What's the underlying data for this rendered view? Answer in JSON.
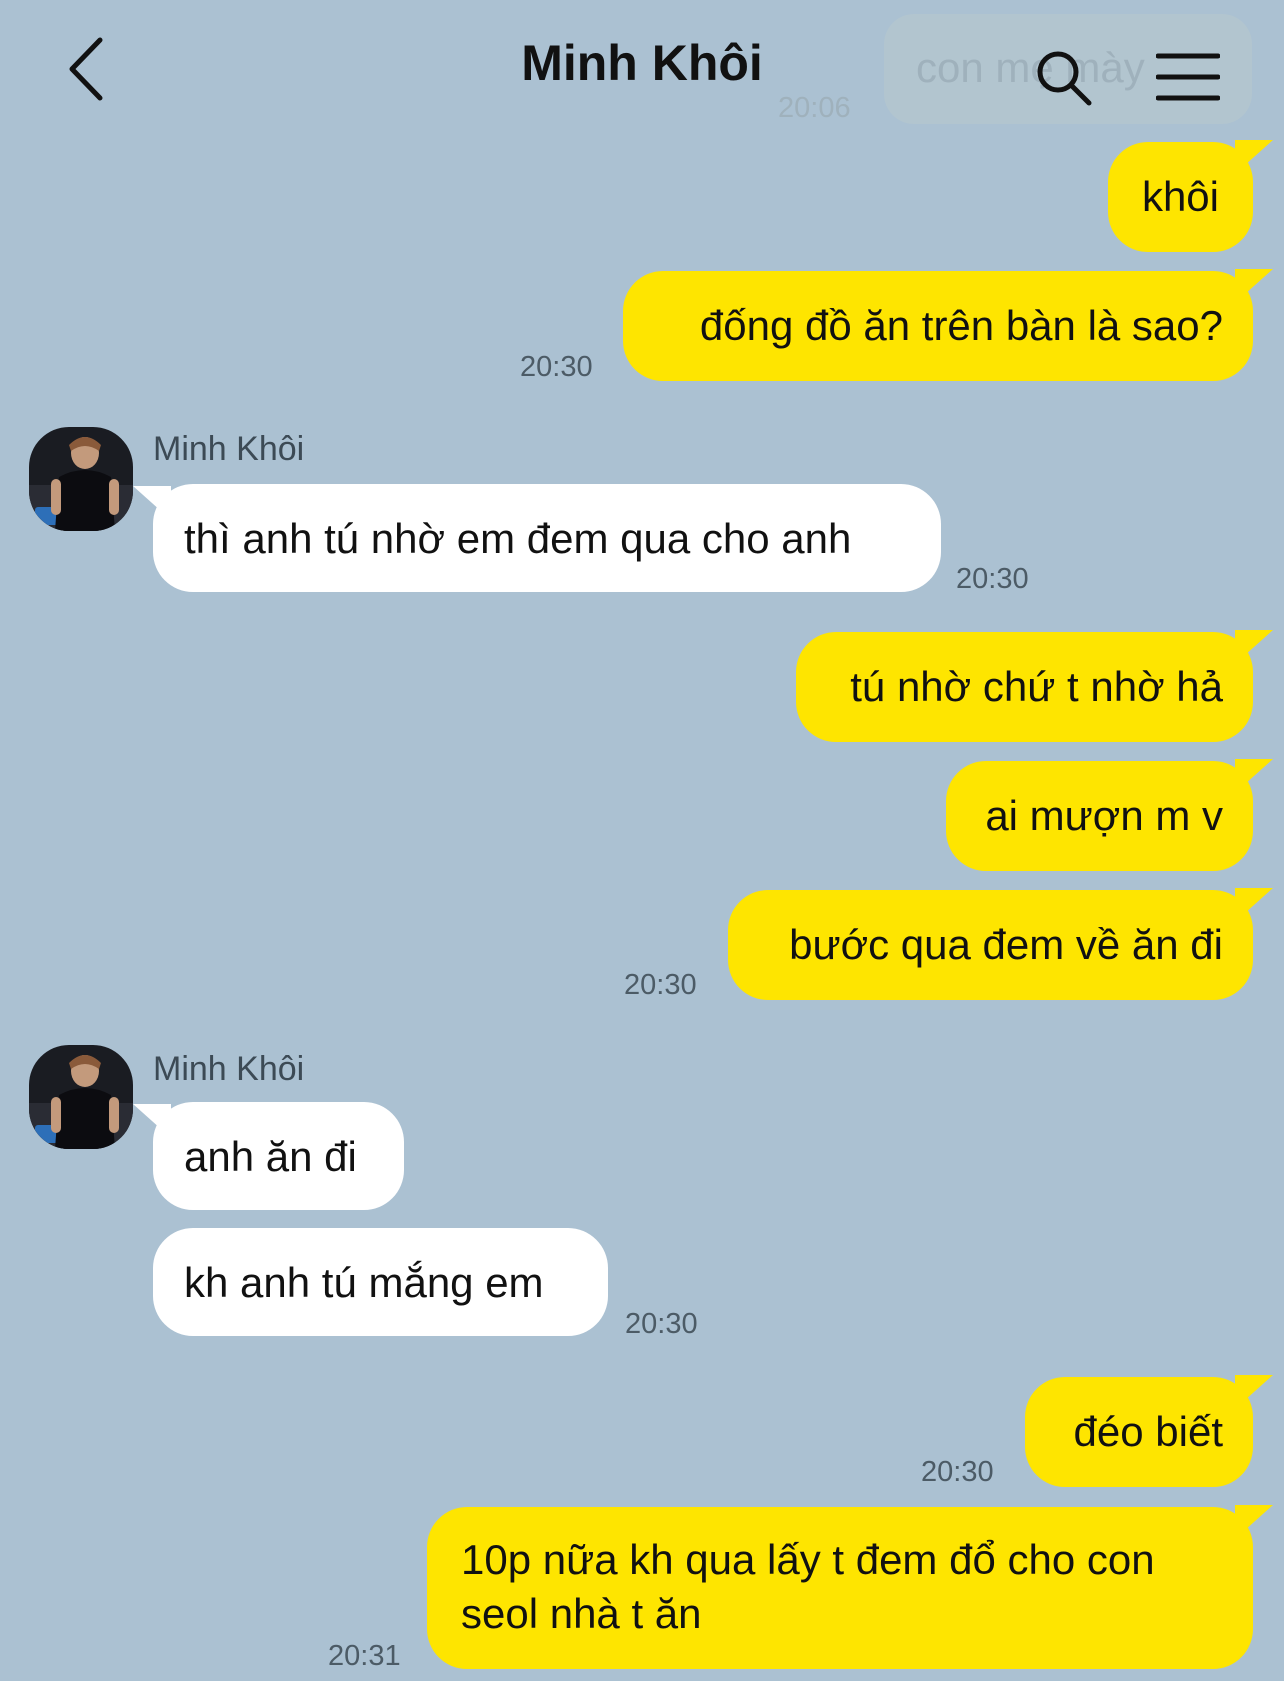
{
  "header": {
    "title": "Minh Khôi",
    "faded_message": "con mẹ mày",
    "faded_time": "20:06"
  },
  "colors": {
    "background": "#abc1d2",
    "outgoing_bubble": "#fee500",
    "incoming_bubble": "#ffffff"
  },
  "icons": {
    "back": "chevron-left-icon",
    "search": "search-icon",
    "menu": "hamburger-menu-icon"
  },
  "messages": [
    {
      "dir": "out",
      "text": "khôi"
    },
    {
      "dir": "out",
      "text": "đống đồ ăn trên bàn là sao?",
      "time": "20:30"
    },
    {
      "dir": "in",
      "sender": "Minh Khôi",
      "text": "thì anh tú nhờ em đem qua cho anh",
      "time": "20:30"
    },
    {
      "dir": "out",
      "text": "tú nhờ chứ t nhờ hả"
    },
    {
      "dir": "out",
      "text": "ai mượn m v"
    },
    {
      "dir": "out",
      "text": "bước qua đem về ăn đi",
      "time": "20:30"
    },
    {
      "dir": "in",
      "sender": "Minh Khôi",
      "text": "anh ăn đi"
    },
    {
      "dir": "in",
      "text": "kh anh tú mắng em",
      "time": "20:30"
    },
    {
      "dir": "out",
      "text": "đéo biết",
      "time": "20:30"
    },
    {
      "dir": "out",
      "text_lines": [
        "10p nữa kh qua lấy t đem đổ cho con",
        "seol nhà t ăn"
      ],
      "time": "20:31"
    }
  ]
}
